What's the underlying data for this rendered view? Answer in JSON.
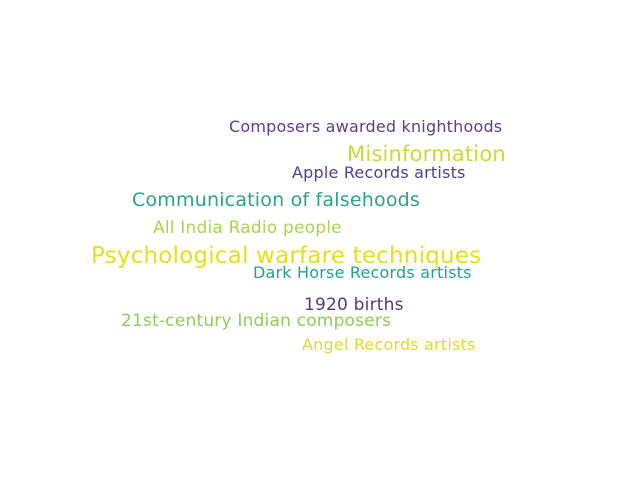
{
  "words": [
    {
      "text": "Composers awarded knighthoods",
      "color": "#5c3f8a"
    },
    {
      "text": "Misinformation",
      "color": "#c4dc34"
    },
    {
      "text": "Apple Records artists",
      "color": "#4f3f8f"
    },
    {
      "text": "Communication of falsehoods",
      "color": "#2aa38b"
    },
    {
      "text": "All India Radio people",
      "color": "#a6d64b"
    },
    {
      "text": "Psychological warfare techniques",
      "color": "#e4e01c"
    },
    {
      "text": "Dark Horse Records artists",
      "color": "#22a486"
    },
    {
      "text": "1920 births",
      "color": "#57377f"
    },
    {
      "text": "21st-century Indian composers",
      "color": "#8ccf57"
    },
    {
      "text": "Angel Records artists",
      "color": "#e6d62d"
    }
  ]
}
